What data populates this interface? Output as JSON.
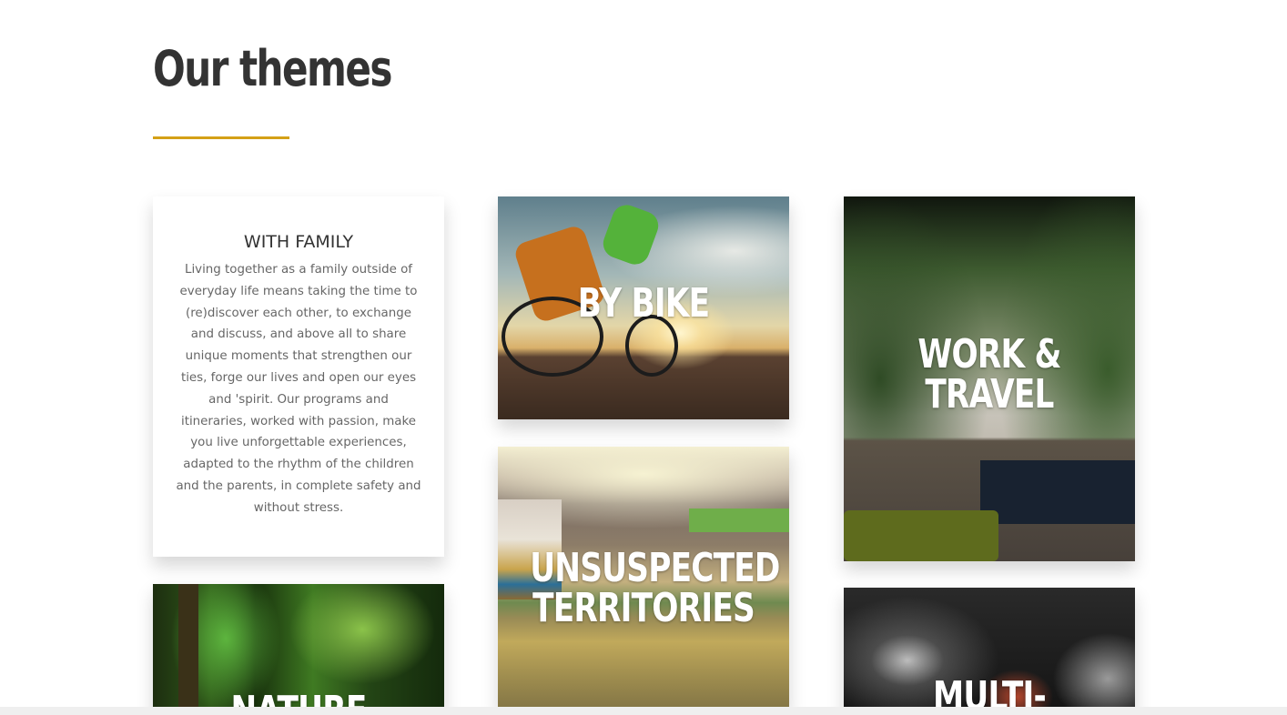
{
  "section": {
    "heading": "Our themes",
    "accent_color": "#d4a017"
  },
  "themes": {
    "family": {
      "title": "WITH FAMILY",
      "description": "Living together as a family outside of everyday life means taking the time to (re)discover each other, to exchange and discuss, and above all to share unique moments that strengthen our ties, forge our lives and open our eyes and 'spirit. Our programs and itineraries, worked with passion, make you live unforgettable experiences, adapted to the rhythm of the children and the parents, in complete safety and without stress."
    },
    "bike": {
      "title": "BY BIKE"
    },
    "work": {
      "title": "WORK & TRAVEL"
    },
    "unsuspected": {
      "title": "UNSUSPECTED TERRITORIES"
    },
    "nature": {
      "title": "NATURE"
    },
    "multi": {
      "title": "MULTI-"
    }
  }
}
